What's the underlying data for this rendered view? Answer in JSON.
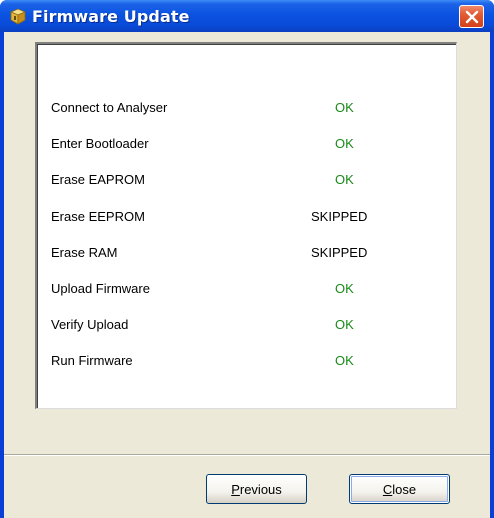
{
  "window": {
    "title": "Firmware Update",
    "icon": "box-icon"
  },
  "steps": [
    {
      "label": "Connect to Analyser",
      "status": "OK"
    },
    {
      "label": "Enter Bootloader",
      "status": "OK"
    },
    {
      "label": "Erase EAPROM",
      "status": "OK"
    },
    {
      "label": "Erase EEPROM",
      "status": "SKIPPED"
    },
    {
      "label": "Erase RAM",
      "status": "SKIPPED"
    },
    {
      "label": "Upload Firmware",
      "status": "OK"
    },
    {
      "label": "Verify Upload",
      "status": "OK"
    },
    {
      "label": "Run Firmware",
      "status": "OK"
    }
  ],
  "buttons": {
    "previous": {
      "mnemonic": "P",
      "rest": "revious"
    },
    "close": {
      "mnemonic": "C",
      "rest": "lose"
    }
  },
  "colors": {
    "ok": "#1a8a1a",
    "skipped": "#000000"
  }
}
